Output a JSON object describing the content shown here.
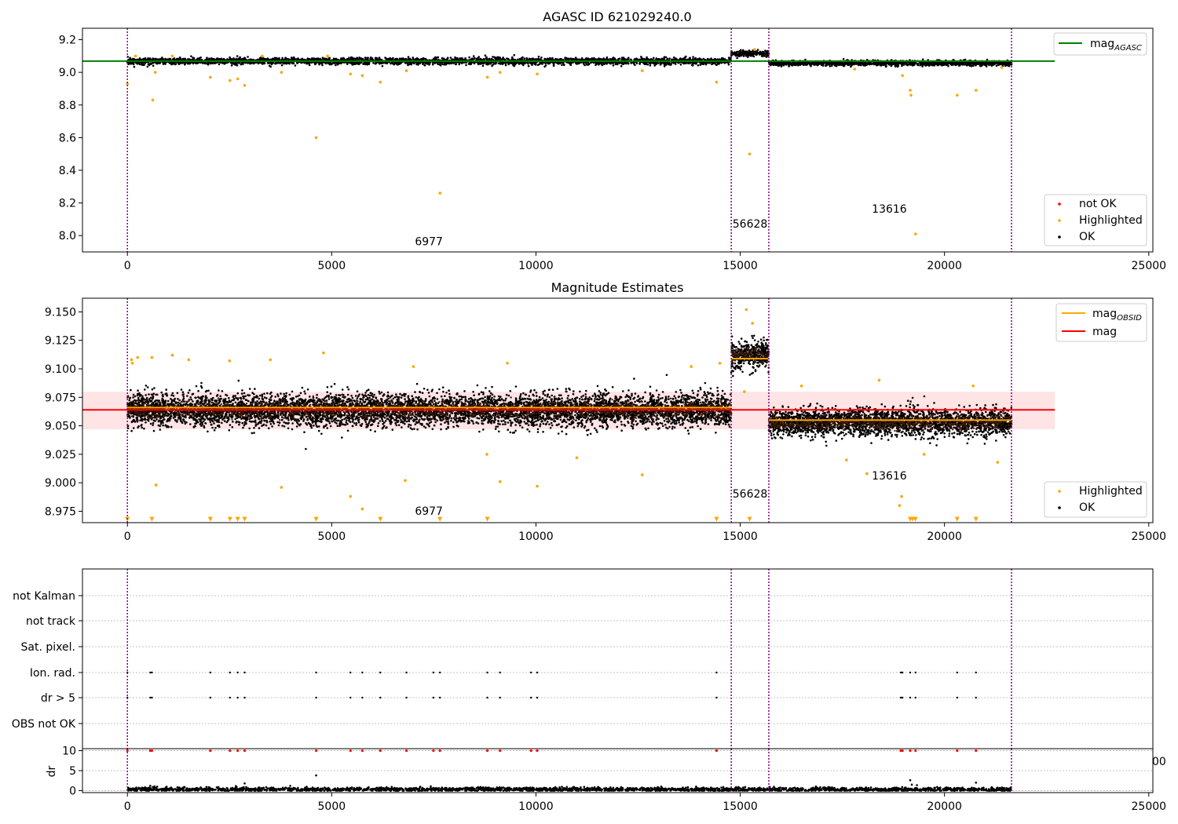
{
  "figure": {
    "background": "#ffffff"
  },
  "colors": {
    "ok": "#000000",
    "highlighted": "#ffa500",
    "not_ok": "#ff0000",
    "mag_agasc": "#008000",
    "mag_line": "#ff0000",
    "band": "#ffdde0",
    "mag_obsid": "#ffa500",
    "obs_divider": "#800080",
    "grid": "#b0b0b0"
  },
  "chart_data": [
    {
      "id": "top",
      "type": "scatter",
      "title": "AGASC ID 621029240.0",
      "xlim": [
        -1100,
        25100
      ],
      "ylim": [
        7.9,
        9.27
      ],
      "xticks": [
        0,
        5000,
        10000,
        15000,
        20000,
        25000
      ],
      "xtick_labels": [
        "0",
        "5000",
        "10000",
        "15000",
        "20000",
        "25000"
      ],
      "yticks": [
        8.0,
        8.2,
        8.4,
        8.6,
        8.8,
        9.0,
        9.2
      ],
      "ytick_labels": [
        "8.0",
        "8.2",
        "8.4",
        "8.6",
        "8.8",
        "9.0",
        "9.2"
      ],
      "obs_boundaries": [
        0,
        14780,
        15700,
        21640
      ],
      "obs_labels": [
        {
          "text": "6977",
          "x": 7380,
          "y": 7.94
        },
        {
          "text": "56628",
          "x": 15240,
          "y": 8.05
        },
        {
          "text": "13616",
          "x": 18650,
          "y": 8.14
        }
      ],
      "hlines": [
        {
          "name_main": "mag",
          "name_sub": "AGASC",
          "y": 9.069,
          "x": [
            -1100,
            22700
          ],
          "color_key": "mag_agasc"
        }
      ],
      "ok_segments": [
        {
          "x": [
            0,
            14780
          ],
          "center": 9.068,
          "spread": 0.018
        },
        {
          "x": [
            14780,
            15700
          ],
          "center": 9.115,
          "spread": 0.016
        },
        {
          "x": [
            15700,
            21640
          ],
          "center": 9.056,
          "spread": 0.014
        }
      ],
      "highlighted_points": [
        [
          0,
          8.93
        ],
        [
          620,
          8.83
        ],
        [
          680,
          9.0
        ],
        [
          2030,
          8.97
        ],
        [
          2510,
          8.95
        ],
        [
          2700,
          8.96
        ],
        [
          2870,
          8.92
        ],
        [
          3770,
          9.0
        ],
        [
          4620,
          8.6
        ],
        [
          5460,
          8.99
        ],
        [
          5750,
          8.98
        ],
        [
          6190,
          8.94
        ],
        [
          6830,
          9.01
        ],
        [
          7650,
          8.26
        ],
        [
          8810,
          8.97
        ],
        [
          9120,
          9.0
        ],
        [
          10030,
          8.99
        ],
        [
          12600,
          9.01
        ],
        [
          14420,
          8.94
        ],
        [
          15230,
          8.5
        ],
        [
          18970,
          8.98
        ],
        [
          19160,
          8.89
        ],
        [
          19180,
          8.86
        ],
        [
          19290,
          8.01
        ],
        [
          20310,
          8.86
        ],
        [
          20770,
          8.89
        ],
        [
          200,
          9.1
        ],
        [
          1100,
          9.1
        ],
        [
          3300,
          9.1
        ],
        [
          4900,
          9.1
        ],
        [
          15350,
          9.14
        ],
        [
          17800,
          9.02
        ],
        [
          21400,
          9.03
        ]
      ],
      "legend_top": [
        {
          "label_main": "mag",
          "label_sub": "AGASC",
          "kind": "line",
          "color_key": "mag_agasc"
        }
      ],
      "legend_bottom": [
        {
          "label": "not OK",
          "kind": "dot",
          "color_key": "not_ok"
        },
        {
          "label": "Highlighted",
          "kind": "dot",
          "color_key": "highlighted"
        },
        {
          "label": "OK",
          "kind": "dot",
          "color_key": "ok"
        }
      ]
    },
    {
      "id": "middle",
      "type": "scatter",
      "title": "Magnitude Estimates",
      "xlim": [
        -1100,
        25100
      ],
      "ylim": [
        8.965,
        9.162
      ],
      "xticks": [
        0,
        5000,
        10000,
        15000,
        20000,
        25000
      ],
      "xtick_labels": [
        "0",
        "5000",
        "10000",
        "15000",
        "20000",
        "25000"
      ],
      "yticks": [
        8.975,
        9.0,
        9.025,
        9.05,
        9.075,
        9.1,
        9.125,
        9.15
      ],
      "ytick_labels": [
        "8.975",
        "9.000",
        "9.025",
        "9.050",
        "9.075",
        "9.100",
        "9.125",
        "9.150"
      ],
      "obs_boundaries": [
        0,
        14780,
        15700,
        21640
      ],
      "obs_labels": [
        {
          "text": "6977",
          "x": 7380,
          "y": 8.972
        },
        {
          "text": "56628",
          "x": 15240,
          "y": 8.987
        },
        {
          "text": "13616",
          "x": 18650,
          "y": 9.003
        }
      ],
      "band": {
        "x": [
          -1100,
          22700
        ],
        "y": [
          9.047,
          9.08
        ]
      },
      "mag_line": {
        "y": 9.064,
        "x": [
          -1100,
          22700
        ]
      },
      "mag_obsid": [
        {
          "x": [
            0,
            14780
          ],
          "y": 9.066
        },
        {
          "x": [
            14780,
            15700
          ],
          "y": 9.109
        },
        {
          "x": [
            15700,
            21640
          ],
          "y": 9.055
        }
      ],
      "ok_segments": [
        {
          "x": [
            0,
            14780
          ],
          "center": 9.064,
          "spread": 0.013
        },
        {
          "x": [
            14780,
            15700
          ],
          "center": 9.112,
          "spread": 0.011
        },
        {
          "x": [
            15700,
            21640
          ],
          "center": 9.053,
          "spread": 0.011
        }
      ],
      "highlighted_points": [
        [
          100,
          9.108
        ],
        [
          120,
          9.105
        ],
        [
          250,
          9.11
        ],
        [
          600,
          9.11
        ],
        [
          700,
          8.998
        ],
        [
          1100,
          9.112
        ],
        [
          1500,
          9.108
        ],
        [
          2500,
          9.107
        ],
        [
          3500,
          9.108
        ],
        [
          3770,
          8.996
        ],
        [
          4800,
          9.114
        ],
        [
          5460,
          8.988
        ],
        [
          5750,
          8.977
        ],
        [
          6800,
          9.002
        ],
        [
          7000,
          9.102
        ],
        [
          8800,
          9.025
        ],
        [
          9120,
          9.001
        ],
        [
          9300,
          9.105
        ],
        [
          10030,
          8.997
        ],
        [
          11000,
          9.022
        ],
        [
          12600,
          9.007
        ],
        [
          13800,
          9.102
        ],
        [
          14500,
          9.105
        ],
        [
          15150,
          9.152
        ],
        [
          15300,
          9.14
        ],
        [
          15100,
          9.08
        ],
        [
          17600,
          9.02
        ],
        [
          18100,
          9.008
        ],
        [
          18400,
          9.09
        ],
        [
          18950,
          8.988
        ],
        [
          18900,
          8.98
        ],
        [
          20700,
          9.085
        ],
        [
          21300,
          9.018
        ],
        [
          19500,
          9.025
        ],
        [
          16500,
          9.085
        ]
      ],
      "low_markers_x": [
        0,
        600,
        2030,
        2510,
        2700,
        2870,
        4620,
        6190,
        7650,
        8810,
        14420,
        15230,
        19160,
        19220,
        19290,
        20310,
        20770
      ],
      "low_marker_y": 8.968,
      "legend_top": [
        {
          "label_main": "mag",
          "label_sub": "OBSID",
          "kind": "line",
          "color_key": "mag_obsid"
        },
        {
          "label_main": "mag",
          "label_sub": "",
          "kind": "line",
          "color_key": "mag_line"
        }
      ],
      "legend_bottom": [
        {
          "label": "Highlighted",
          "kind": "dot",
          "color_key": "highlighted"
        },
        {
          "label": "OK",
          "kind": "dot",
          "color_key": "ok"
        }
      ]
    },
    {
      "id": "flags",
      "type": "scatter",
      "xlim": [
        -1100,
        25100
      ],
      "categories": [
        "not Kalman",
        "not track",
        "Sat. pixel.",
        "Ion. rad.",
        "dr > 5",
        "OBS not OK"
      ],
      "obs_boundaries": [
        0,
        14780,
        15700,
        21640
      ],
      "flag_points": {
        "Ion. rad.": [
          0,
          560,
          600,
          2030,
          2510,
          2700,
          2870,
          4620,
          5460,
          5750,
          6190,
          6830,
          7490,
          7650,
          8810,
          9120,
          9880,
          10030,
          14420,
          18930,
          18970,
          19160,
          19290,
          20310,
          20770
        ],
        "dr > 5": [
          0,
          560,
          600,
          2030,
          2510,
          2700,
          2870,
          4620,
          5460,
          5750,
          6190,
          6830,
          7490,
          7650,
          8810,
          9120,
          9880,
          10030,
          14420,
          18930,
          18970,
          19160,
          19290,
          20310,
          20770
        ]
      },
      "stray_tick_label": "00"
    },
    {
      "id": "dr",
      "type": "scatter",
      "xlim": [
        -1100,
        25100
      ],
      "ylim": [
        -0.5,
        10.5
      ],
      "ylabel": "dr",
      "yticks": [
        0,
        5,
        10
      ],
      "ytick_labels": [
        "0",
        "5",
        "10"
      ],
      "xticks": [
        0,
        5000,
        10000,
        15000,
        20000,
        25000
      ],
      "xtick_labels": [
        "0",
        "5000",
        "10000",
        "15000",
        "20000",
        "25000"
      ],
      "obs_boundaries": [
        0,
        14780,
        15700,
        21640
      ],
      "base_segment": {
        "x": [
          0,
          21640
        ],
        "center": 0.3,
        "spread": 0.25
      },
      "red_points_x": [
        0,
        560,
        600,
        2030,
        2510,
        2700,
        2870,
        4620,
        5460,
        5750,
        6190,
        6830,
        7490,
        7650,
        8810,
        9120,
        9880,
        10030,
        14420,
        18930,
        18970,
        19160,
        19290,
        20310,
        20770
      ],
      "red_points_y": 10,
      "black_extra": [
        [
          4620,
          3.8
        ],
        [
          19160,
          2.6
        ],
        [
          20770,
          2.0
        ],
        [
          2870,
          1.8
        ],
        [
          19200,
          1.5
        ],
        [
          560,
          1.2
        ]
      ]
    }
  ]
}
